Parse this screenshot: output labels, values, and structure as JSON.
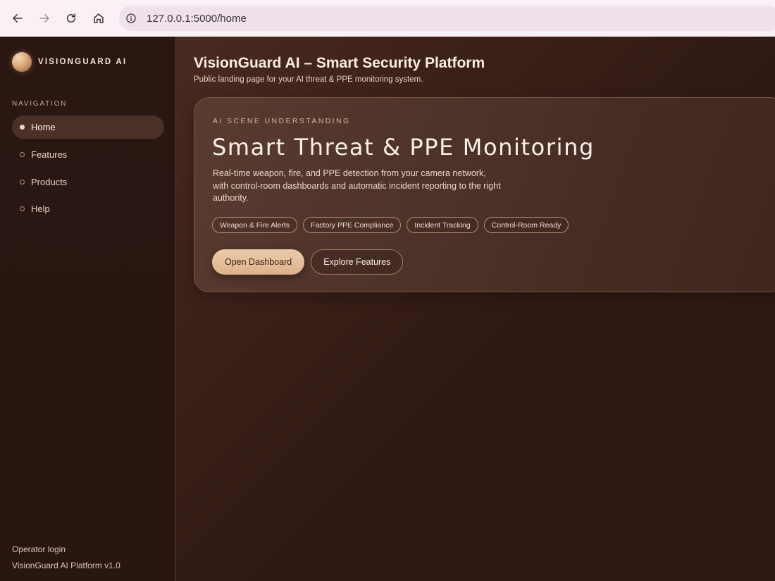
{
  "browser": {
    "url": "127.0.0.1:5000/home"
  },
  "sidebar": {
    "brand_name": "VISIONGUARD AI",
    "nav_heading": "NAVIGATION",
    "items": [
      {
        "label": "Home",
        "active": true
      },
      {
        "label": "Features",
        "active": false
      },
      {
        "label": "Products",
        "active": false
      },
      {
        "label": "Help",
        "active": false
      }
    ],
    "footer_link": "Operator login",
    "footer_version": "VisionGuard AI Platform v1.0"
  },
  "header": {
    "title": "VisionGuard AI – Smart Security Platform",
    "subtitle": "Public landing page for your AI threat & PPE monitoring system."
  },
  "hero": {
    "eyebrow": "AI SCENE UNDERSTANDING",
    "title": "Smart Threat & PPE Monitoring",
    "description": "Real-time weapon, fire, and PPE detection from your camera network, with control-room dashboards and automatic incident reporting to the right authority.",
    "tags": [
      "Weapon & Fire Alerts",
      "Factory PPE Compliance",
      "Incident Tracking",
      "Control-Room Ready"
    ],
    "primary_button": "Open Dashboard",
    "secondary_button": "Explore Features"
  },
  "colors": {
    "accent": "#e3bc98",
    "sidebar_bg": "#2a1611",
    "main_bg": "#3c2119"
  }
}
